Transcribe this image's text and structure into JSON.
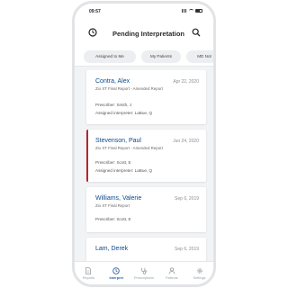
{
  "status": {
    "time": "09:57"
  },
  "header": {
    "title": "Pending Interpretation"
  },
  "filters": [
    {
      "label": "Assigned to Me"
    },
    {
      "label": "My Patients"
    },
    {
      "label": "MD Not"
    }
  ],
  "cards": [
    {
      "name": "Contra, Alex",
      "date": "Apr 22, 2020",
      "report": "Zio XT Final Report - Amended Report",
      "prescriber": "Prescriber: Smith, J",
      "interpreter": "Assigned interpreter: LaBue, Q"
    },
    {
      "name": "Stevenson, Paul",
      "date": "Jun 24, 2020",
      "report": "Zio XT Final Report - Amended Report",
      "prescriber": "Prescriber: Scott, E",
      "interpreter": "Assigned interpreter: LaBue, Q"
    },
    {
      "name": "Williams, Valerie",
      "date": "Sep 6, 2019",
      "report": "Zio XT Final Report",
      "prescriber": "Prescriber: Scott, E"
    },
    {
      "name": "Lam, Derek",
      "date": "Sep 6, 2019"
    }
  ],
  "tabs": [
    {
      "label": "Reports",
      "icon": "document-icon"
    },
    {
      "label": "Interpret",
      "icon": "clock-icon"
    },
    {
      "label": "Prescriptions",
      "icon": "stethoscope-icon"
    },
    {
      "label": "Patients",
      "icon": "person-icon"
    },
    {
      "label": "Settings",
      "icon": "gear-icon"
    }
  ],
  "colors": {
    "accent": "#2c5fa0",
    "name": "#0a4a8c",
    "flag": "#b3262d"
  }
}
